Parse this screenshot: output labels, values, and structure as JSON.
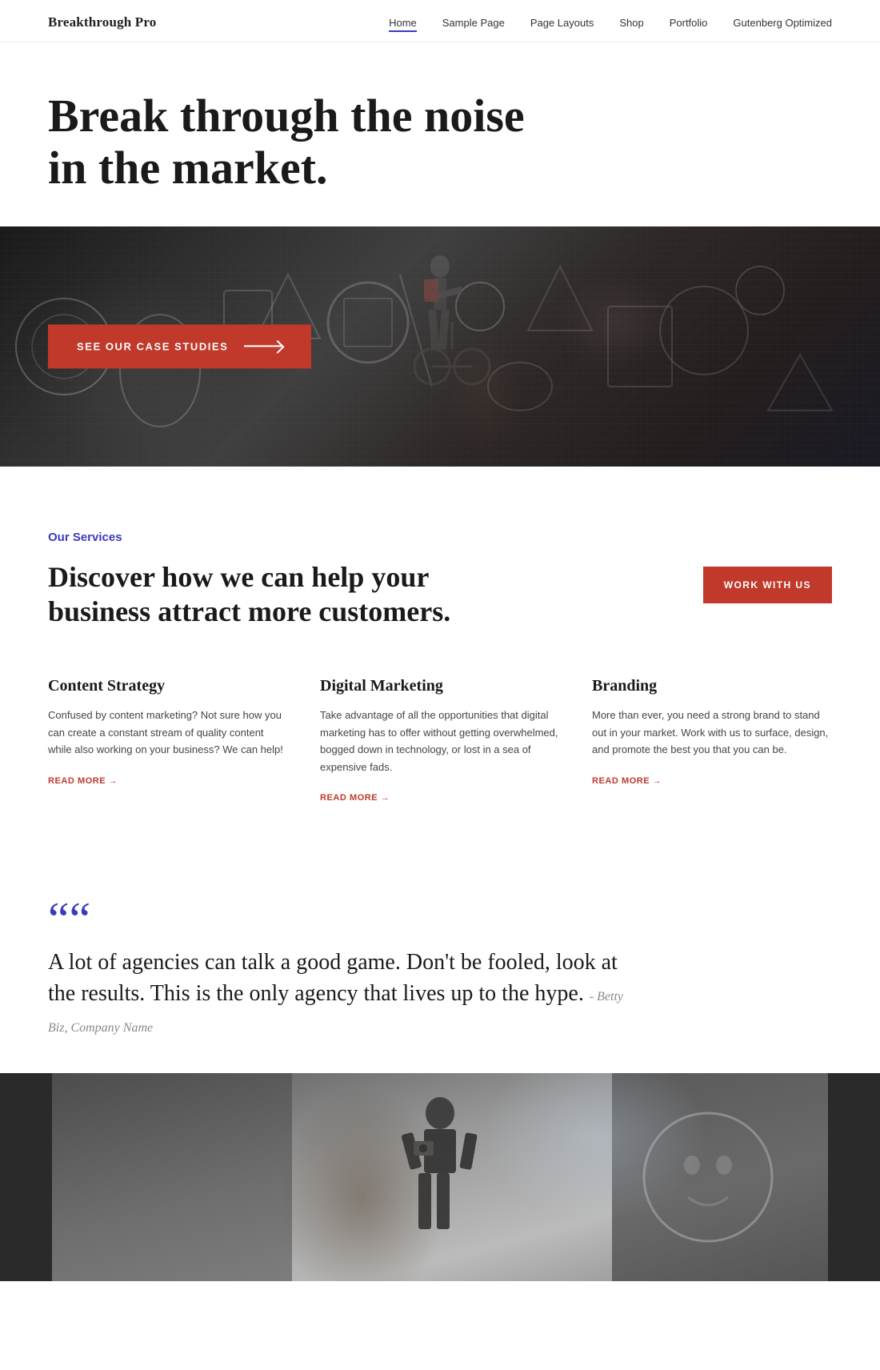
{
  "site": {
    "title": "Breakthrough Pro"
  },
  "nav": {
    "items": [
      {
        "label": "Home",
        "active": true
      },
      {
        "label": "Sample Page",
        "active": false
      },
      {
        "label": "Page Layouts",
        "active": false
      },
      {
        "label": "Shop",
        "active": false
      },
      {
        "label": "Portfolio",
        "active": false
      },
      {
        "label": "Gutenberg Optimized",
        "active": false
      }
    ]
  },
  "hero": {
    "headline_line1": "Break through the noise",
    "headline_line2": "in the market.",
    "cta_button": "SEE OUR CASE STUDIES"
  },
  "services": {
    "label": "Our Services",
    "headline": "Discover how we can help your business attract more customers.",
    "work_button": "WORK WITH US",
    "items": [
      {
        "title": "Content Strategy",
        "description": "Confused by content marketing? Not sure how you can create a constant stream of quality content while also working on your business? We can help!",
        "read_more": "READ MORE →"
      },
      {
        "title": "Digital Marketing",
        "description": "Take advantage of all the opportunities that digital marketing has to offer without getting overwhelmed, bogged down in technology, or lost in a sea of expensive fads.",
        "read_more": "READ MORE →"
      },
      {
        "title": "Branding",
        "description": "More than ever, you need a strong brand to stand out in your market. Work with us to surface, design, and promote the best you that you can be.",
        "read_more": "READ MORE →"
      }
    ]
  },
  "testimonial": {
    "quote": "A lot of agencies can talk a good game. Don't be fooled, look at the results. This is the only agency that lives up to the hype.",
    "attribution": "- Betty Biz, Company Name",
    "quote_mark": "““"
  }
}
